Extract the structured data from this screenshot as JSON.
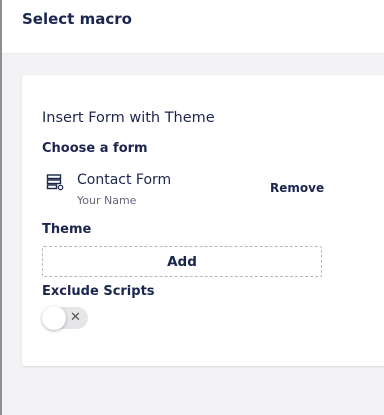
{
  "header": {
    "title": "Select macro"
  },
  "macro": {
    "name": "Insert Form with Theme",
    "form_label": "Choose a form",
    "selected_form": {
      "name": "Contact Form",
      "subtitle": "Your Name",
      "remove_label": "Remove",
      "icon": "form-icon"
    },
    "theme_label": "Theme",
    "theme_add_label": "Add",
    "exclude_label": "Exclude Scripts",
    "exclude_toggle": {
      "enabled": false,
      "off_glyph": "✕"
    }
  },
  "colors": {
    "text": "#1b264f",
    "muted": "#68677a",
    "background": "#f3f3f5"
  }
}
